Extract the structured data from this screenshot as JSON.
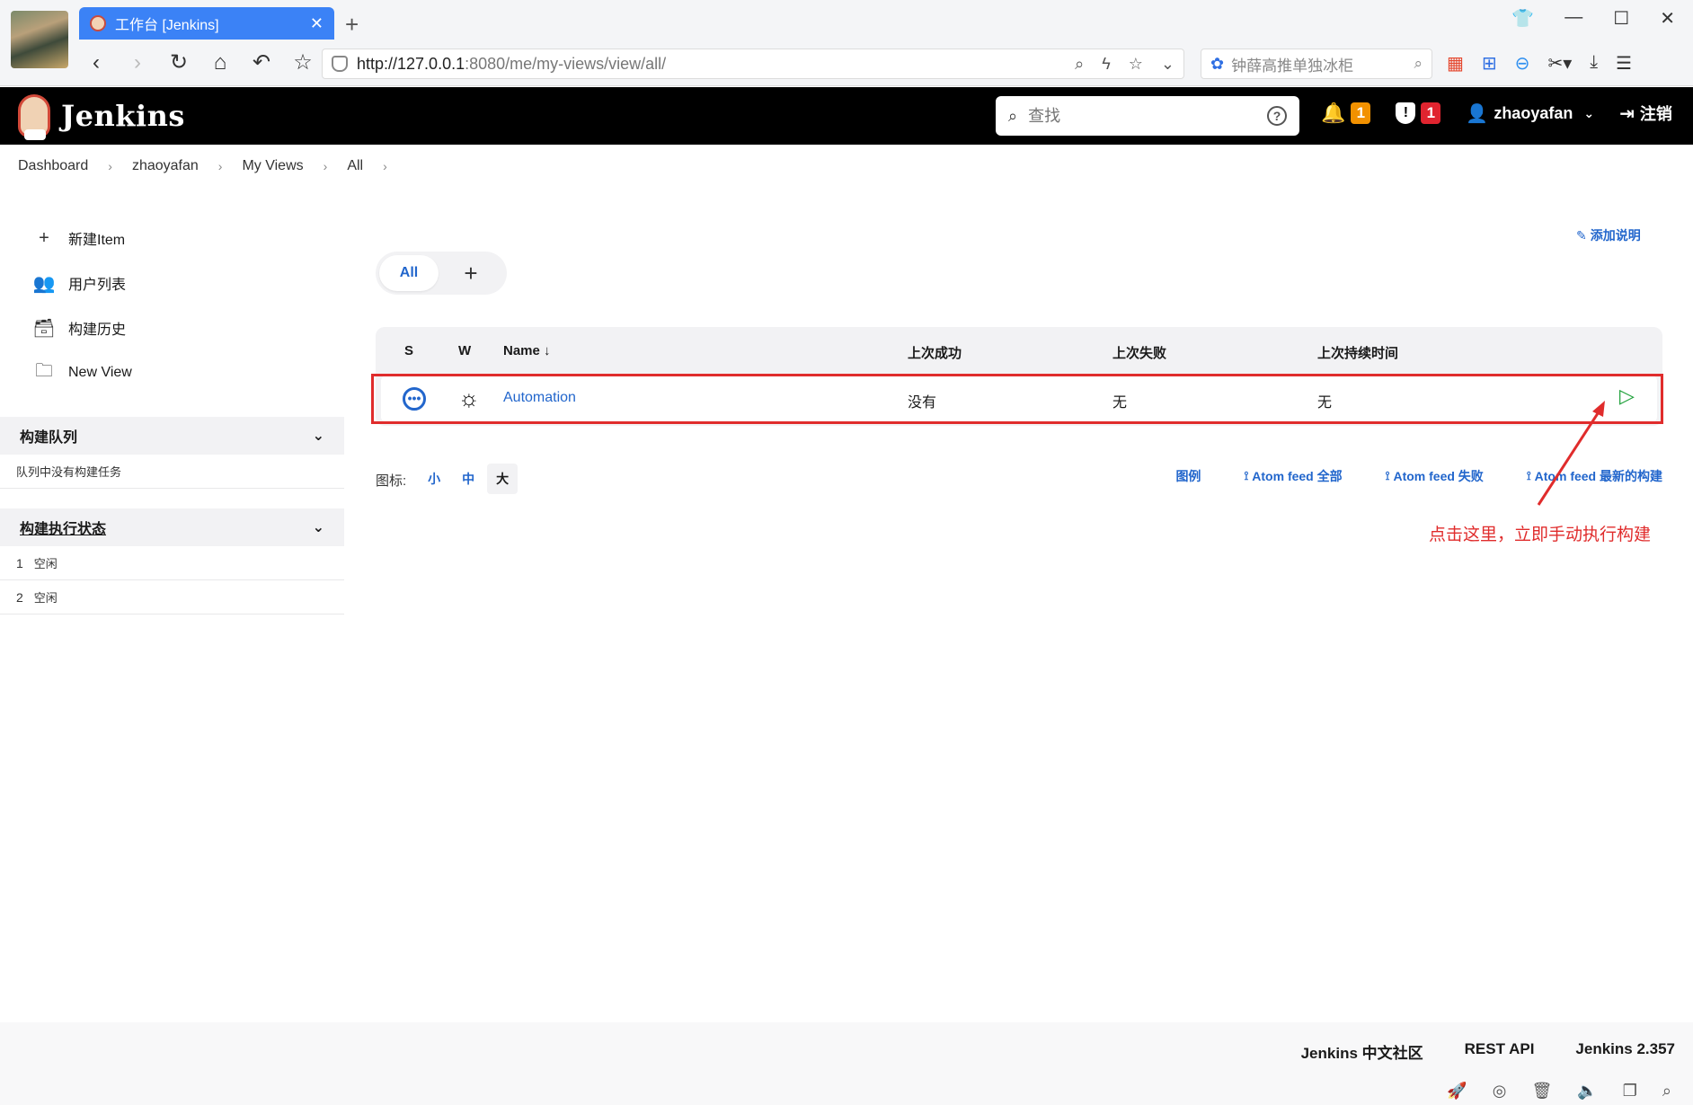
{
  "browser": {
    "tab_title": "工作台 [Jenkins]",
    "tab_close": "✕",
    "new_tab": "+",
    "url_host": "http://127.0.0.1",
    "url_rest": ":8080/me/my-views/view/all/",
    "search_placeholder": "钟薛高推单独冰柜"
  },
  "header": {
    "logo_text": "Jenkins",
    "search_placeholder": "查找",
    "notifications_count": "1",
    "security_count": "1",
    "username": "zhaoyafan",
    "logout": "注销"
  },
  "breadcrumb": [
    "Dashboard",
    "zhaoyafan",
    "My Views",
    "All"
  ],
  "sidebar": {
    "tasks": [
      {
        "label": "新建Item",
        "icon": "plus-icon"
      },
      {
        "label": "用户列表",
        "icon": "users-icon"
      },
      {
        "label": "构建历史",
        "icon": "inbox-icon"
      },
      {
        "label": "New View",
        "icon": "folder-icon"
      }
    ],
    "queue": {
      "title": "构建队列",
      "empty_text": "队列中没有构建任务"
    },
    "executors": {
      "title": "构建执行状态",
      "rows": [
        {
          "num": "1",
          "status": "空闲"
        },
        {
          "num": "2",
          "status": "空闲"
        }
      ]
    }
  },
  "main": {
    "add_description": "添加说明",
    "view_tab": "All",
    "table": {
      "headers": {
        "s": "S",
        "w": "W",
        "name": "Name ↓",
        "last_success": "上次成功",
        "last_failure": "上次失败",
        "last_duration": "上次持续时间"
      },
      "rows": [
        {
          "name": "Automation",
          "last_success": "没有",
          "last_failure": "无",
          "last_duration": "无"
        }
      ]
    },
    "icon_size": {
      "label": "图标:",
      "small": "小",
      "medium": "中",
      "large": "大"
    },
    "legend": "图例",
    "feeds": [
      "Atom feed 全部",
      "Atom feed 失败",
      "Atom feed 最新的构建"
    ],
    "annotation": "点击这里，立即手动执行构建"
  },
  "footer": {
    "community": "Jenkins 中文社区",
    "rest_api": "REST API",
    "version": "Jenkins 2.357"
  },
  "colors": {
    "link": "#2266cc",
    "annotation": "#e02c2c",
    "run": "#20a13b",
    "header_bg": "#000000"
  }
}
